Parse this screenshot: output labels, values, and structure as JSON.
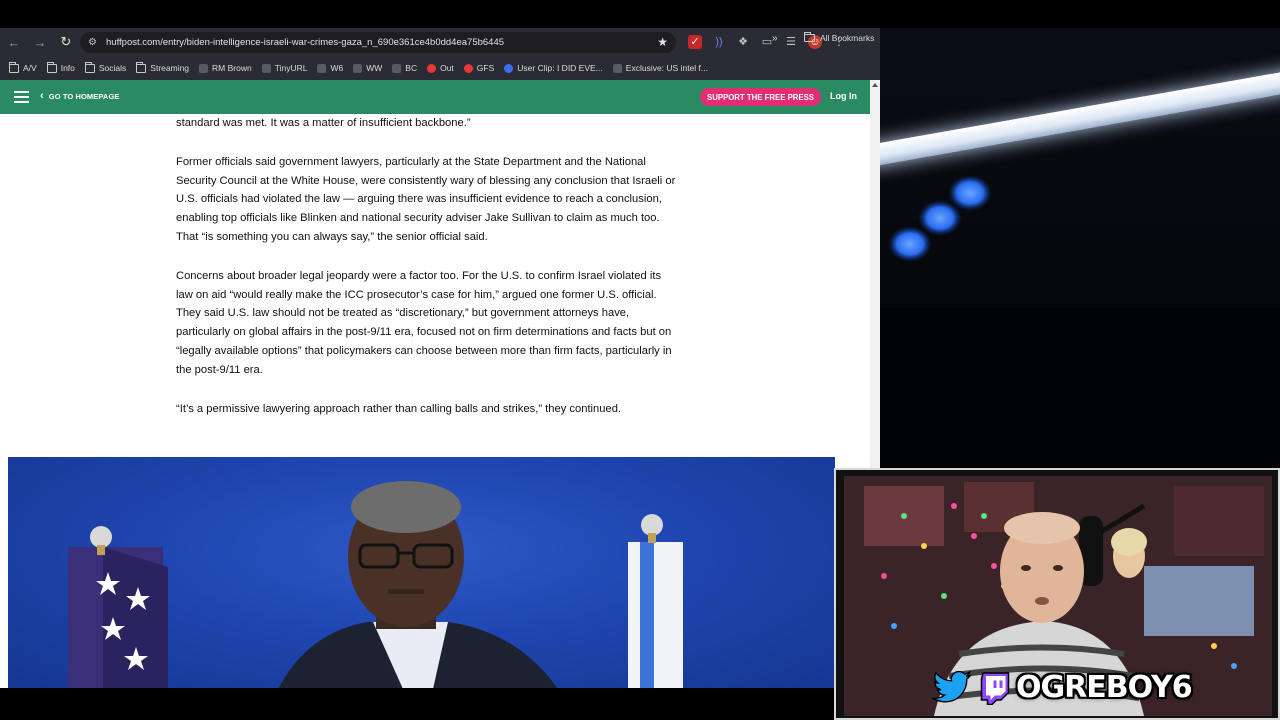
{
  "browser": {
    "url": "huffpost.com/entry/biden-intelligence-israeli-war-crimes-gaza_n_690e361ce4b0dd4ea75b6445",
    "bookmarks": [
      {
        "label": "A/V",
        "icon": "folder-icon"
      },
      {
        "label": "Info",
        "icon": "folder-icon"
      },
      {
        "label": "Socials",
        "icon": "folder-icon"
      },
      {
        "label": "Streaming",
        "icon": "folder-icon"
      },
      {
        "label": "RM Brown",
        "icon": "site-icon"
      },
      {
        "label": "TinyURL",
        "icon": "site-icon"
      },
      {
        "label": "W6",
        "icon": "site-icon"
      },
      {
        "label": "WW",
        "icon": "site-icon"
      },
      {
        "label": "BC",
        "icon": "site-icon"
      },
      {
        "label": "Out",
        "icon": "youtube-icon"
      },
      {
        "label": "GFS",
        "icon": "youtube-icon"
      },
      {
        "label": "User Clip: I DID EVE...",
        "icon": "play-icon"
      },
      {
        "label": "Exclusive: US intel f...",
        "icon": "site-icon"
      }
    ],
    "more_bookmarks": "»",
    "all_bookmarks": "All Bookmarks"
  },
  "site": {
    "go_home": "GO TO HOMEPAGE",
    "support": "SUPPORT THE FREE PRESS",
    "login": "Log In"
  },
  "article": {
    "paragraphs": [
      "standard was met. It was a matter of insufficient backbone.”",
      "Former officials said government lawyers, particularly at the State Department and the National Security Council at the White House, were consistently wary of blessing any conclusion that Israeli or U.S. officials had violated the law — arguing there was insufficient evidence to reach a conclusion, enabling top officials like Blinken and national security adviser Jake Sullivan to claim as much too. That “is something you can always say,” the senior official said.",
      "Concerns about broader legal jeopardy were a factor too. For the U.S. to confirm Israel violated its law on aid “would really make the ICC prosecutor’s case for him,” argued one former U.S. official. They said U.S. law should not be treated as “discretionary,” but government attorneys have, particularly on global affairs in the post-9/11 era, focused not on firm determinations and facts but on “legally available options” that policymakers can choose between more than firm facts, particularly in the post-9/11 era.",
      "“It’s a permissive lawyering approach rather than calling balls and strikes,” they continued."
    ]
  },
  "stream": {
    "handle": "OGREBOY6"
  },
  "colors": {
    "header_green": "#2a8a60",
    "support_pink": "#e12d73",
    "photo_blue": "#1f46b0"
  }
}
